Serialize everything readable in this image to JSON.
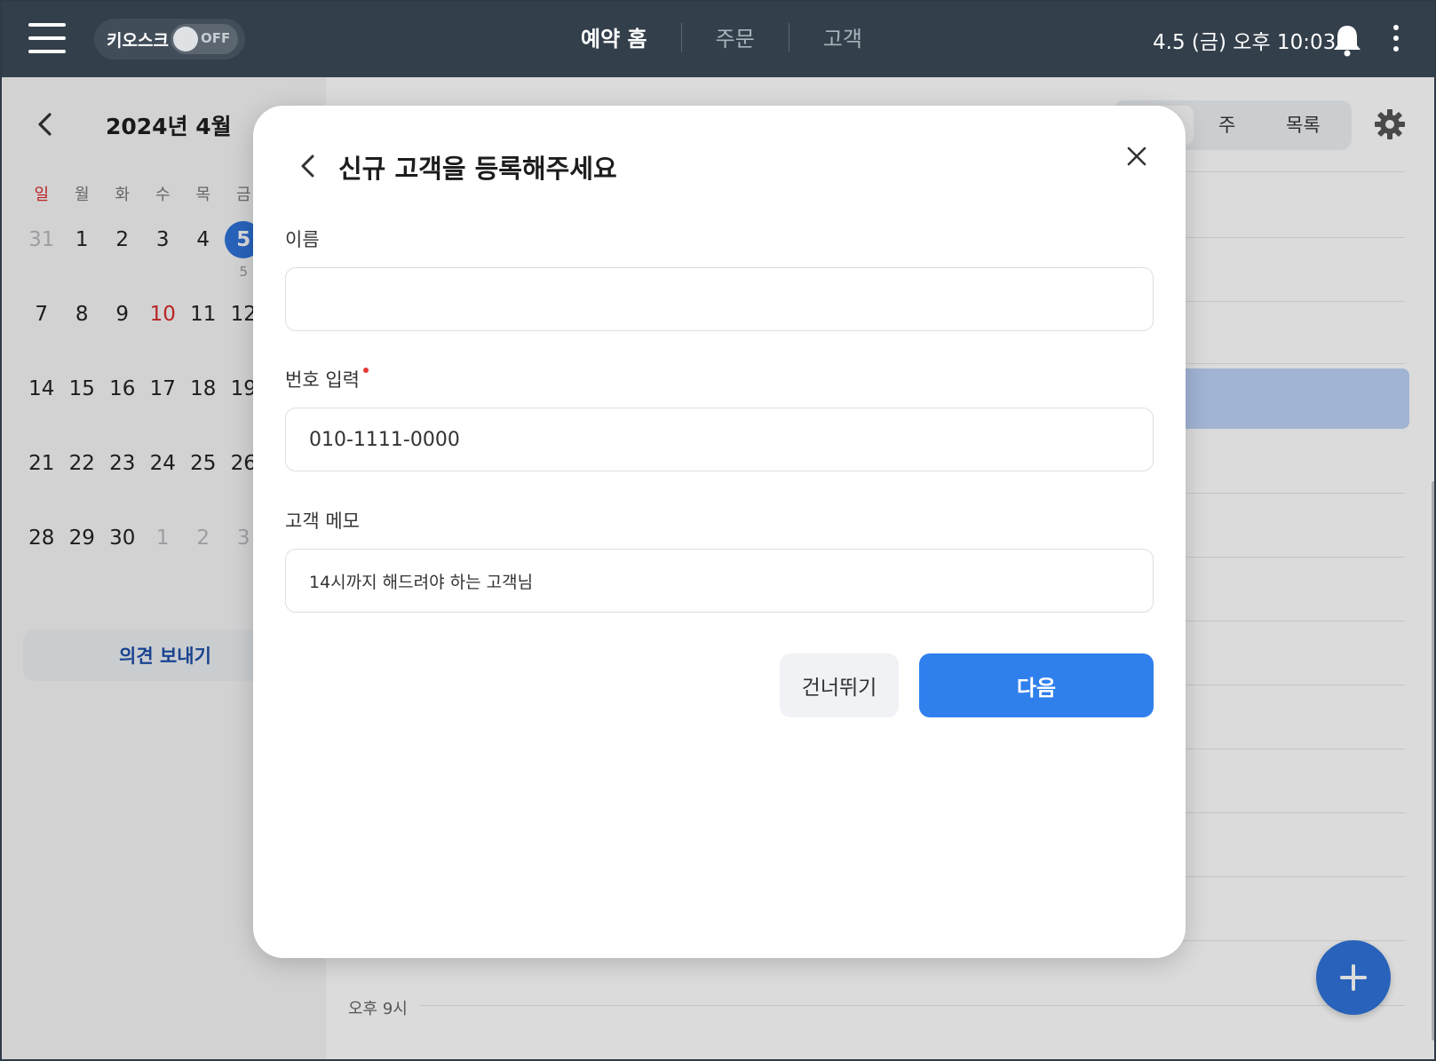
{
  "topbar": {
    "kiosk_label": "키오스크",
    "kiosk_state": "OFF",
    "tabs": [
      {
        "label": "예약 홈",
        "active": true
      },
      {
        "label": "주문",
        "active": false
      },
      {
        "label": "고객",
        "active": false
      }
    ],
    "datetime": "4.5 (금) 오후 10:03"
  },
  "calendar": {
    "month_title": "2024년 4월",
    "weekdays": [
      "일",
      "월",
      "화",
      "수",
      "목",
      "금"
    ],
    "weeks": [
      [
        {
          "d": "31",
          "dim": true
        },
        {
          "d": "1"
        },
        {
          "d": "2"
        },
        {
          "d": "3"
        },
        {
          "d": "4"
        },
        {
          "d": "5",
          "today": true,
          "sub": "5"
        }
      ],
      [
        {
          "d": "7"
        },
        {
          "d": "8"
        },
        {
          "d": "9"
        },
        {
          "d": "10",
          "red": true
        },
        {
          "d": "11"
        },
        {
          "d": "12"
        }
      ],
      [
        {
          "d": "14"
        },
        {
          "d": "15"
        },
        {
          "d": "16"
        },
        {
          "d": "17"
        },
        {
          "d": "18"
        },
        {
          "d": "19"
        }
      ],
      [
        {
          "d": "21"
        },
        {
          "d": "22"
        },
        {
          "d": "23"
        },
        {
          "d": "24"
        },
        {
          "d": "25"
        },
        {
          "d": "26"
        }
      ],
      [
        {
          "d": "28"
        },
        {
          "d": "29"
        },
        {
          "d": "30"
        },
        {
          "d": "1",
          "dim": true
        },
        {
          "d": "2",
          "dim": true
        },
        {
          "d": "3",
          "dim": true
        }
      ]
    ],
    "feedback_label": "의견 보내기"
  },
  "schedule": {
    "view_options": [
      "",
      "주",
      "목록"
    ],
    "time_label": "오후 9시"
  },
  "modal": {
    "title": "신규 고객을 등록해주세요",
    "name_label": "이름",
    "name_value": "",
    "phone_label": "번호 입력",
    "phone_value": "010-1111-0000",
    "memo_label": "고객 메모",
    "memo_value": "14시까지 해드려야 하는 고객님",
    "skip_label": "건너뛰기",
    "next_label": "다음"
  },
  "colors": {
    "topbar": "#333f4b",
    "accent": "#2f80ed",
    "today": "#2f73d9",
    "holiday": "#d92b2b",
    "required": "#e53935"
  }
}
